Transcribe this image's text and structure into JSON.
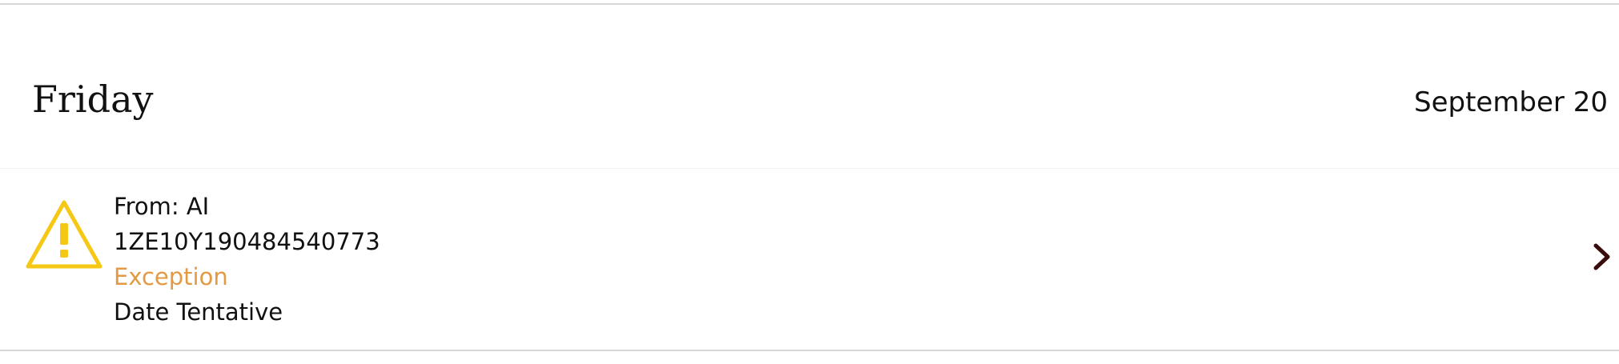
{
  "day_header": {
    "day_name": "Friday",
    "date": "September 20"
  },
  "shipment": {
    "from_label": "From: AI",
    "tracking_number": "1ZE10Y190484540773",
    "status": "Exception",
    "delivery_date_status": "Date Tentative",
    "icons": {
      "status_icon": "warning-triangle-icon",
      "navigation_icon": "chevron-right-icon"
    }
  },
  "colors": {
    "warning_icon": "#f4c814",
    "exception_text": "#e39a42",
    "chevron": "#3a0d0d",
    "divider": "#d6d6d6"
  }
}
